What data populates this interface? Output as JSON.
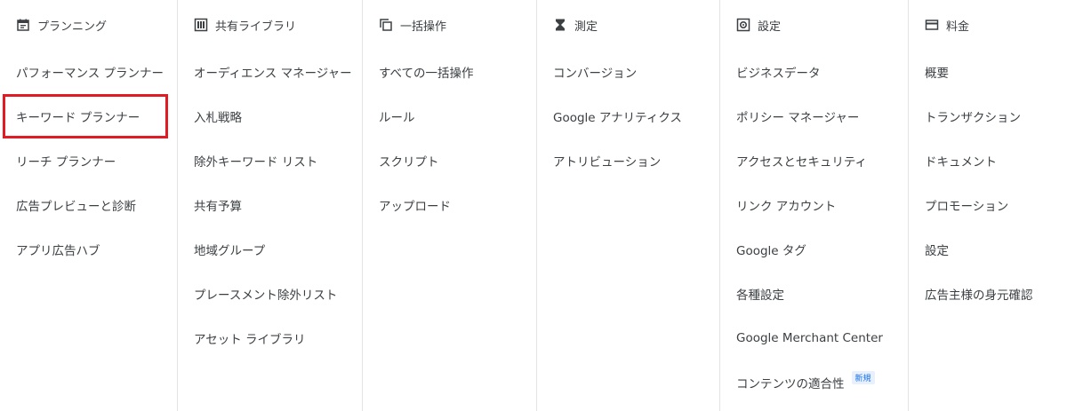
{
  "columns": [
    {
      "header": "プランニング",
      "icon": "calendar-icon",
      "items": [
        "パフォーマンス プランナー",
        "キーワード プランナー",
        "リーチ プランナー",
        "広告プレビューと診断",
        "アプリ広告ハブ"
      ],
      "highlighted_item": "キーワード プランナー"
    },
    {
      "header": "共有ライブラリ",
      "icon": "library-icon",
      "items": [
        "オーディエンス マネージャー",
        "入札戦略",
        "除外キーワード リスト",
        "共有予算",
        "地域グループ",
        "プレースメント除外リスト",
        "アセット ライブラリ"
      ]
    },
    {
      "header": "一括操作",
      "icon": "bulk-copy-icon",
      "items": [
        "すべての一括操作",
        "ルール",
        "スクリプト",
        "アップロード"
      ]
    },
    {
      "header": "測定",
      "icon": "hourglass-icon",
      "items": [
        "コンバージョン",
        "Google アナリティクス",
        "アトリビューション"
      ]
    },
    {
      "header": "設定",
      "icon": "settings-icon",
      "items": [
        "ビジネスデータ",
        "ポリシー マネージャー",
        "アクセスとセキュリティ",
        "リンク アカウント",
        "Google タグ",
        "各種設定",
        "Google Merchant Center",
        "コンテンツの適合性"
      ],
      "new_badge": "新規"
    },
    {
      "header": "料金",
      "icon": "credit-card-icon",
      "items": [
        "概要",
        "トランザクション",
        "ドキュメント",
        "プロモーション",
        "設定",
        "広告主様の身元確認"
      ]
    }
  ],
  "colors": {
    "highlight": "#e01b24",
    "badge": "#1a73e8"
  }
}
